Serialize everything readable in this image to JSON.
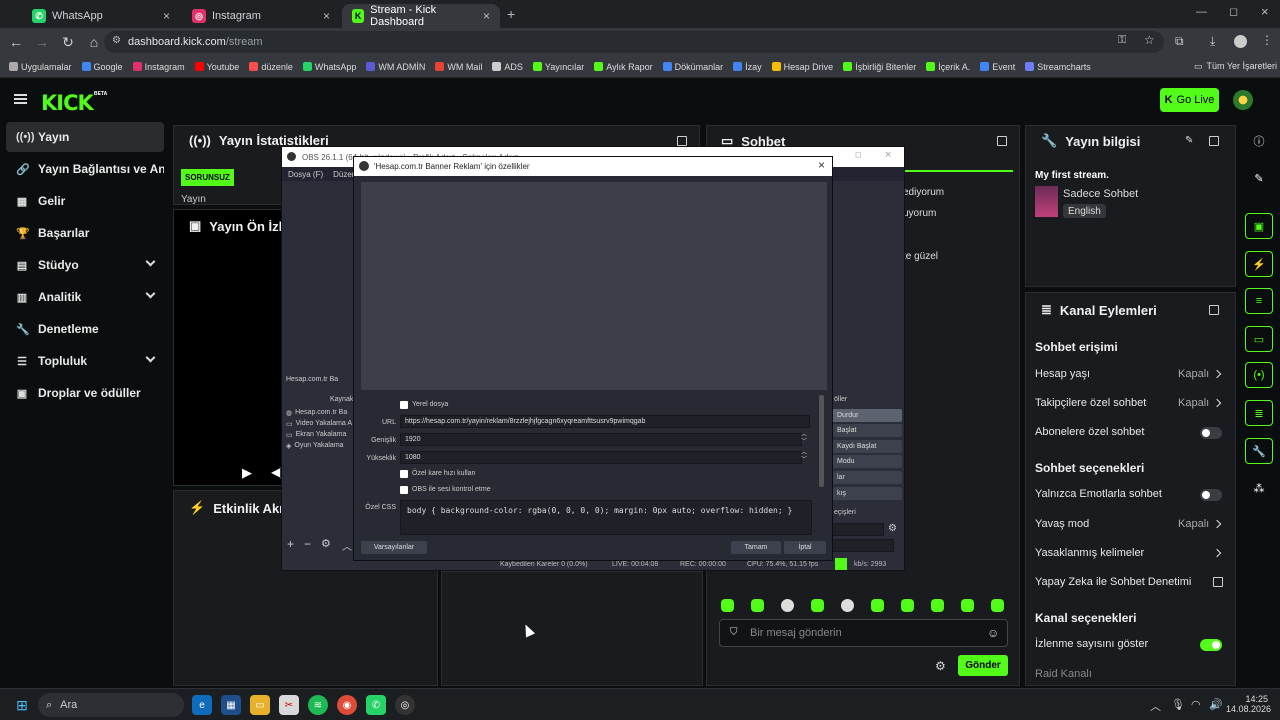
{
  "browser": {
    "tabs": [
      {
        "label": "WhatsApp",
        "icon": "whatsapp-icon",
        "color": "#25d366"
      },
      {
        "label": "Instagram",
        "icon": "instagram-icon",
        "color": "#e1306c"
      },
      {
        "label": "Stream - Kick Dashboard",
        "icon": "kick-icon",
        "color": "#53fc18"
      }
    ],
    "url_host": "dashboard.kick.com",
    "url_path": "/stream",
    "bookmarks": [
      {
        "label": "Uygulamalar",
        "color": "#aaaaaa"
      },
      {
        "label": "Google",
        "color": "#4285f4"
      },
      {
        "label": "Instagram",
        "color": "#e1306c"
      },
      {
        "label": "Youtube",
        "color": "#ff0000"
      },
      {
        "label": "düzenle",
        "color": "#ff4d4d"
      },
      {
        "label": "WhatsApp",
        "color": "#25d366"
      },
      {
        "label": "WM ADMİN",
        "color": "#5b5bd6"
      },
      {
        "label": "WM Mail",
        "color": "#ea4335"
      },
      {
        "label": "ADS",
        "color": "#cccccc"
      },
      {
        "label": "Yayıncılar",
        "color": "#53fc18"
      },
      {
        "label": "Aylık Rapor",
        "color": "#53fc18"
      },
      {
        "label": "Dökümanlar",
        "color": "#4285f4"
      },
      {
        "label": "İzay",
        "color": "#4285f4"
      },
      {
        "label": "Hesap Drive",
        "color": "#fbbc05"
      },
      {
        "label": "İşbirliği Bitenler",
        "color": "#53fc18"
      },
      {
        "label": "İçerik A.",
        "color": "#53fc18"
      },
      {
        "label": "Event",
        "color": "#4285f4"
      },
      {
        "label": "Streamcharts",
        "color": "#6e7cf7"
      }
    ],
    "all_bookmarks": "Tüm Yer İşaretleri"
  },
  "kick": {
    "logo": "KICK",
    "beta": "BETA",
    "go_live": "Go Live",
    "brand_color": "#53fc18"
  },
  "sidebar": {
    "items": [
      {
        "label": "Yayın",
        "icon": "broadcast-icon"
      },
      {
        "label": "Yayın Bağlantısı ve Anahtarı",
        "icon": "link-icon"
      },
      {
        "label": "Gelir",
        "icon": "revenue-icon"
      },
      {
        "label": "Başarılar",
        "icon": "trophy-icon"
      },
      {
        "label": "Stüdyo",
        "icon": "studio-icon"
      },
      {
        "label": "Analitik",
        "icon": "analytics-icon"
      },
      {
        "label": "Denetleme",
        "icon": "wrench-icon"
      },
      {
        "label": "Topluluk",
        "icon": "community-icon"
      },
      {
        "label": "Droplar ve ödüller",
        "icon": "gift-icon"
      }
    ]
  },
  "panels": {
    "stats_title": "Yayın İstatistikleri",
    "status_badge": "SORUNSUZ",
    "stat_label": "Yayın",
    "preview_title": "Yayın Ön İzleme",
    "activity_title": "Etkinlik Akışı",
    "chat_title": "Sohbet",
    "chat_lines": [
      "ediyorum",
      "uyorum",
      "te güzel"
    ],
    "chat_placeholder": "Bir mesaj gönderin",
    "send": "Gönder"
  },
  "info": {
    "title": "Yayın bilgisi",
    "stream_title": "My first stream.",
    "category": "Sadece Sohbet",
    "language": "English"
  },
  "actions": {
    "title": "Kanal Eylemleri",
    "chat_access": "Sohbet erişimi",
    "account_age": "Hesap yaşı",
    "followers_only": "Takipçilere özel sohbet",
    "subs_only": "Abonelere özel sohbet",
    "off": "Kapalı",
    "chat_options": "Sohbet seçenekleri",
    "emote_only": "Yalnızca Emotlarla sohbet",
    "slow_mode": "Yavaş mod",
    "banned_words": "Yasaklanmış kelimeler",
    "ai_moderation": "Yapay Zeka ile Sohbet Denetimi",
    "channel_options": "Kanal seçenekleri",
    "show_viewers": "İzlenme sayısını göster",
    "raid": "Raid Kanalı"
  },
  "obs": {
    "window_title": "OBS 26.1.1 (64-bit, windows) - Profil: Adsız - Sahneler: Adsız",
    "menu": [
      "Dosya (F)",
      "Düzen"
    ],
    "sources_label": "Hesap.com.tr Ba",
    "sources_header": "Kaynak",
    "sources": [
      "Hesap.com.tr Ba",
      "Video Yakalama A",
      "Ekran Yakalama",
      "Oyun Yakalama"
    ],
    "controls_header": "öller",
    "controls": [
      "Durdur",
      "Başlat",
      "Kaydı Başlat",
      "Modu",
      "lar",
      "kış"
    ],
    "transitions_label": "eçişleri",
    "status": {
      "dropped": "Kaybedilen Kareler 0 (0.0%)",
      "live": "LIVE: 00:04:08",
      "rec": "REC: 00:00:00",
      "cpu": "CPU: 75.4%, 51.15 fps",
      "kbps": "kb/s: 2993"
    }
  },
  "dialog": {
    "title": "'Hesap.com.tr Banner Reklam' için özellikler",
    "local_file": "Yerel dosya",
    "url_label": "URL",
    "url": "https://hesap.com.tr/yayin/reklam/8rzzlejhjfgcagn6xyqreamfttsusrv9pwimqgab",
    "width_label": "Genişlik",
    "width": "1920",
    "height_label": "Yükseklik",
    "height": "1080",
    "custom_fps": "Özel kare hızı kullan",
    "obs_audio": "OBS ile sesi kontrol etme",
    "css_label": "Özel CSS",
    "css": "body { background-color: rgba(0, 0, 0, 0); margin: 0px auto; overflow: hidden; }",
    "defaults": "Varsayılanlar",
    "ok": "Tamam",
    "cancel": "İptal"
  },
  "taskbar": {
    "search": "Ara",
    "time": "14:25",
    "date": "14.08.2026"
  }
}
